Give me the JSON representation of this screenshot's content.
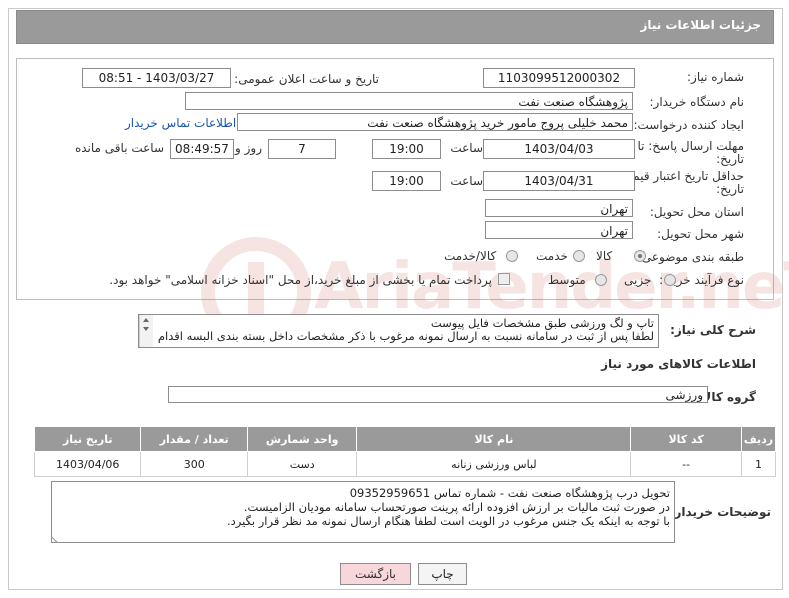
{
  "header": {
    "title": "جزئیات اطلاعات نیاز"
  },
  "form": {
    "need_number_label": "شماره نیاز:",
    "need_number": "1103099512000302",
    "announce_label": "تاریخ و ساعت اعلان عمومی:",
    "announce_value": "1403/03/27 - 08:51",
    "buyer_org_label": "نام دستگاه خریدار:",
    "buyer_org": "پژوهشگاه صنعت نفت",
    "creator_label": "ایجاد کننده درخواست:",
    "creator": "محمد خلیلی پروج مامور خرید پژوهشگاه صنعت نفت",
    "contact_link": "اطلاعات تماس خریدار",
    "reply_deadline_label_1": "مهلت ارسال پاسخ: تا",
    "reply_deadline_label_2": "تاریخ:",
    "reply_date": "1403/04/03",
    "time_label": "ساعت",
    "reply_time": "19:00",
    "days_value": "7",
    "days_label": "روز و",
    "remaining_time": "08:49:57",
    "remaining_label": "ساعت باقی مانده",
    "price_validity_label_1": "حداقل تاریخ اعتبار قیمت: تا",
    "price_validity_label_2": "تاریخ:",
    "price_date": "1403/04/31",
    "price_time": "19:00",
    "province_label": "استان محل تحویل:",
    "province": "تهران",
    "city_label": "شهر محل تحویل:",
    "city": "تهران",
    "category_label": "طبقه بندی موضوعی:",
    "category_options": [
      "کالا",
      "خدمت",
      "کالا/خدمت"
    ],
    "category_selected": "کالا",
    "process_label": "نوع فرآیند خرید :",
    "process_options": [
      "جزیی",
      "متوسط"
    ],
    "payment_note": "پرداخت تمام یا بخشی از مبلغ خرید،از محل \"اسناد خزانه اسلامی\" خواهد بود."
  },
  "description": {
    "label": "شرح کلی نیاز:",
    "line1": "تاپ و لگ ورزشی طبق مشخصات فایل پیوست",
    "line2": "لطفا پس از ثبت در سامانه نسبت به ارسال نمونه مرغوب با ذکر مشخصات داخل بسته بندی البسه اقدام"
  },
  "goods": {
    "section_title": "اطلاعات کالاهای مورد نیاز",
    "group_label": "گروه کالا:",
    "group_value": "ورزشی",
    "columns": [
      "ردیف",
      "کد کالا",
      "نام کالا",
      "واحد شمارش",
      "تعداد / مقدار",
      "تاریخ نیاز"
    ],
    "rows": [
      [
        "1",
        "--",
        "لباس ورزشی زنانه",
        "دست",
        "300",
        "1403/04/06"
      ]
    ]
  },
  "buyer_notes": {
    "label": "توضیحات خریدار:",
    "line1": "تحویل درب پژوهشگاه صنعت نفت - شماره تماس 09352959651",
    "line2": "در صورت ثبت مالیات بر ارزش افزوده ارائه پرینت صورتحساب سامانه مودیان الزامیست.",
    "line3": "با توجه به اینکه یک جنس مرغوب در الویت است لطفا هنگام ارسال نمونه مد نظر قرار بگیرد."
  },
  "buttons": {
    "print": "چاپ",
    "back": "بازگشت"
  },
  "watermark": {
    "text": "AriaTender.neT"
  }
}
